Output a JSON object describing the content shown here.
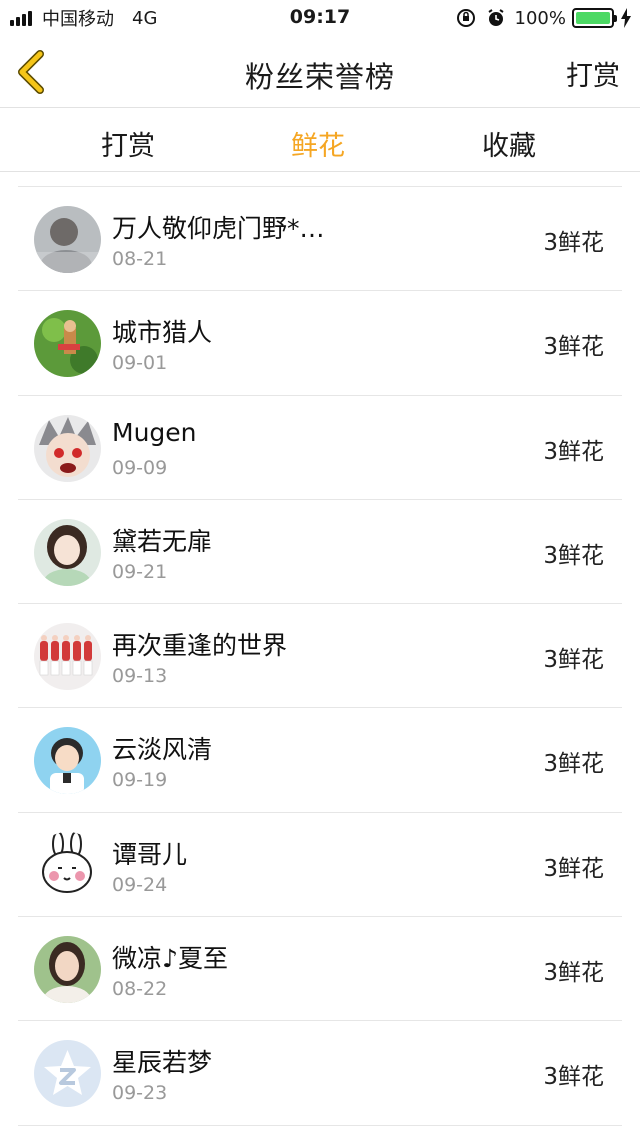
{
  "status": {
    "carrier": "中国移动",
    "network": "4G",
    "time": "09:17",
    "battery": "100%",
    "battery_level": 1.0,
    "battery_color": "#4cd964"
  },
  "nav": {
    "title": "粉丝荣誉榜",
    "right_label": "打赏",
    "back_icon": "chevron-left-icon",
    "accent": "#f5c518"
  },
  "tabs": [
    {
      "label": "打赏",
      "active": false
    },
    {
      "label": "鲜花",
      "active": true
    },
    {
      "label": "收藏",
      "active": false
    }
  ],
  "active_color": "#f5a623",
  "fans": [
    {
      "name": "万人敬仰虎门野*…",
      "date": "08-21",
      "amount": "3鲜花",
      "avatar": "photo-avatar-gray"
    },
    {
      "name": "城市猎人",
      "date": "09-01",
      "amount": "3鲜花",
      "avatar": "game-avatar-green"
    },
    {
      "name": "Mugen",
      "date": "09-09",
      "amount": "3鲜花",
      "avatar": "anime-avatar"
    },
    {
      "name": "黛若无扉",
      "date": "09-21",
      "amount": "3鲜花",
      "avatar": "girl-avatar"
    },
    {
      "name": "再次重逢的世界",
      "date": "09-13",
      "amount": "3鲜花",
      "avatar": "dancers-avatar"
    },
    {
      "name": "云淡风清",
      "date": "09-19",
      "amount": "3鲜花",
      "avatar": "cartoon-boy-avatar"
    },
    {
      "name": "谭哥儿",
      "date": "09-24",
      "amount": "3鲜花",
      "avatar": "bunny-avatar"
    },
    {
      "name": "微凉♪夏至",
      "date": "08-22",
      "amount": "3鲜花",
      "avatar": "woman-photo-avatar"
    },
    {
      "name": "星辰若梦",
      "date": "09-23",
      "amount": "3鲜花",
      "avatar": "qq-default-avatar"
    }
  ]
}
